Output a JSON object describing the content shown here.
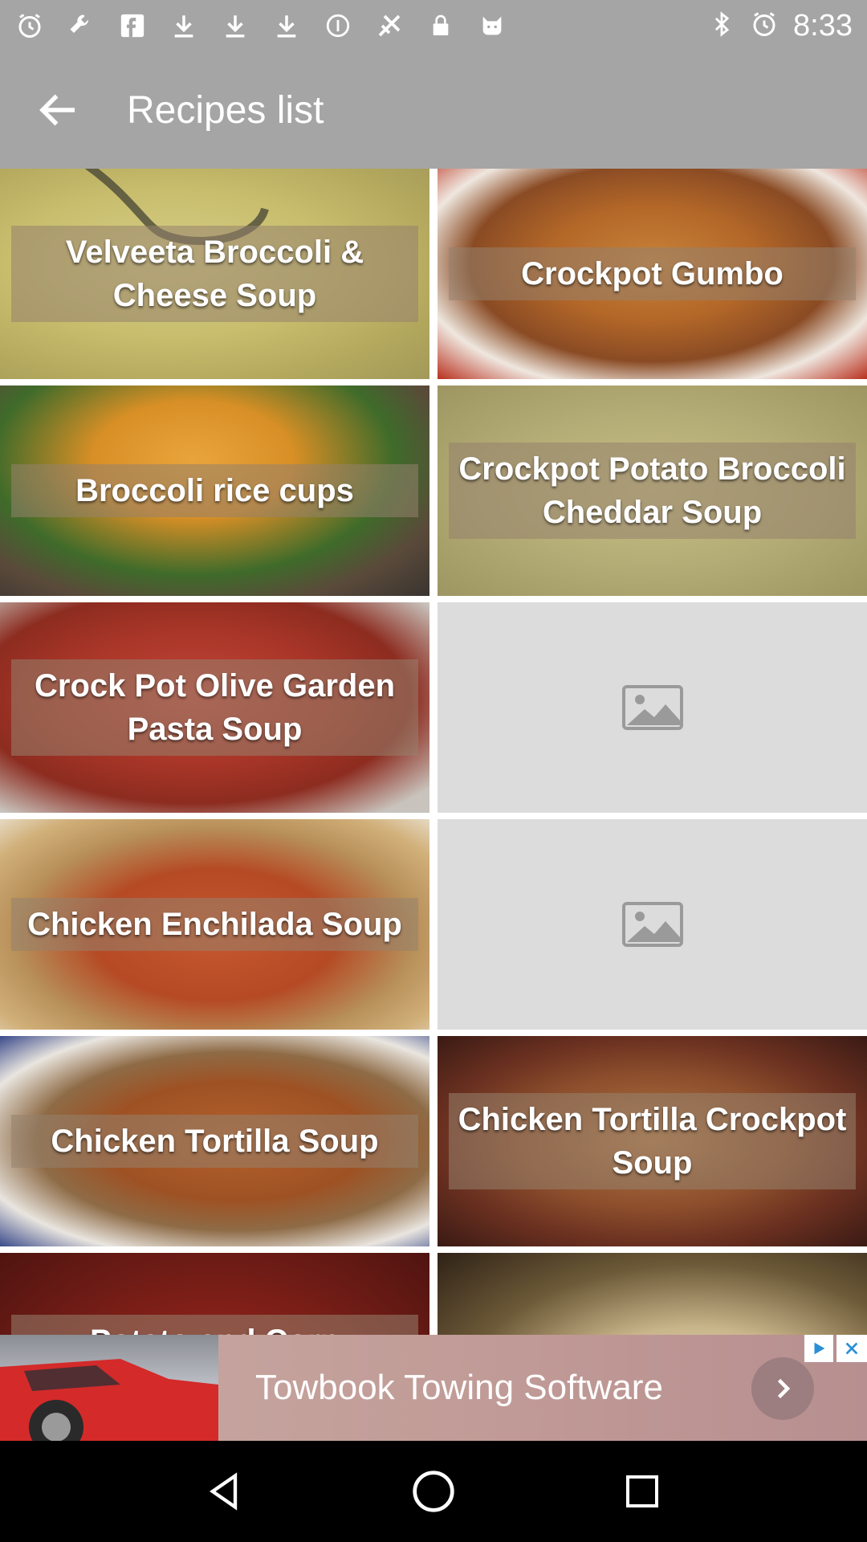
{
  "status_bar": {
    "time": "8:33",
    "left_icons": [
      "alarm-icon",
      "wrench-icon",
      "facebook-icon",
      "download-icon",
      "download-icon",
      "download-icon",
      "info-icon",
      "fax-icon",
      "lock-icon",
      "cat-icon"
    ],
    "right_icons": [
      "bluetooth-icon",
      "alarm-icon"
    ]
  },
  "app_bar": {
    "title": "Recipes list",
    "back_icon": "arrow-back-icon"
  },
  "recipes": [
    {
      "label": "Velveeta Broccoli & Cheese Soup",
      "image": "soup-cheese"
    },
    {
      "label": "Crockpot Gumbo",
      "image": "gumbo"
    },
    {
      "label": "Broccoli rice cups",
      "image": "rice-cups"
    },
    {
      "label": "Crockpot Potato Broccoli Cheddar Soup",
      "image": "potato-soup"
    },
    {
      "label": "Crock Pot Olive Garden Pasta Soup",
      "image": "pasta-soup"
    },
    {
      "label": "",
      "image": "placeholder"
    },
    {
      "label": "Chicken Enchilada Soup",
      "image": "enchilada-soup"
    },
    {
      "label": "",
      "image": "placeholder"
    },
    {
      "label": "Chicken Tortilla Soup",
      "image": "tortilla-soup"
    },
    {
      "label": "Chicken Tortilla Crockpot Soup",
      "image": "tortilla-crockpot"
    },
    {
      "label": "Potato and Corn",
      "image": "potato-corn"
    },
    {
      "label": "",
      "image": "bean-soup"
    }
  ],
  "ad": {
    "text": "Towbook Towing Software",
    "choices_icon": "adchoices-icon",
    "close_icon": "close-icon"
  },
  "nav_bar": {
    "back": "nav-back-icon",
    "home": "nav-home-icon",
    "recents": "nav-recents-icon"
  }
}
